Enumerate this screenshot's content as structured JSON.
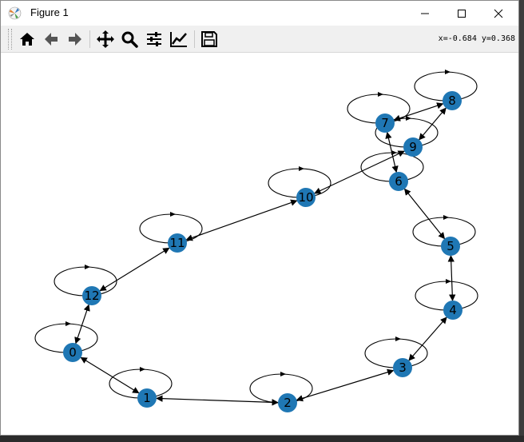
{
  "window": {
    "title": "Figure 1",
    "controls": [
      "minimize",
      "maximize",
      "close"
    ]
  },
  "toolbar": {
    "buttons": [
      {
        "name": "home",
        "icon": "home-icon"
      },
      {
        "name": "back",
        "icon": "arrow-left-icon"
      },
      {
        "name": "forward",
        "icon": "arrow-right-icon"
      },
      {
        "name": "pan",
        "icon": "move-icon"
      },
      {
        "name": "zoom",
        "icon": "magnifier-icon"
      },
      {
        "name": "subplots",
        "icon": "sliders-icon"
      },
      {
        "name": "edit-axes",
        "icon": "line-chart-icon"
      },
      {
        "name": "save",
        "icon": "floppy-disk-icon"
      }
    ],
    "coordinates": "x=-0.684 y=0.368"
  },
  "graph": {
    "node_color": "#1f77b4",
    "edge_color": "#000000",
    "nodes": [
      "0",
      "1",
      "2",
      "3",
      "4",
      "5",
      "6",
      "7",
      "8",
      "9",
      "10",
      "11",
      "12"
    ],
    "self_loops": [
      "0",
      "1",
      "2",
      "3",
      "4",
      "5",
      "6",
      "7",
      "8",
      "9",
      "10",
      "11",
      "12"
    ],
    "edges": [
      [
        "0",
        "1"
      ],
      [
        "1",
        "2"
      ],
      [
        "2",
        "3"
      ],
      [
        "3",
        "4"
      ],
      [
        "4",
        "5"
      ],
      [
        "5",
        "6"
      ],
      [
        "6",
        "7"
      ],
      [
        "7",
        "8"
      ],
      [
        "8",
        "9"
      ],
      [
        "9",
        "10"
      ],
      [
        "10",
        "11"
      ],
      [
        "11",
        "12"
      ],
      [
        "12",
        "0"
      ]
    ]
  }
}
